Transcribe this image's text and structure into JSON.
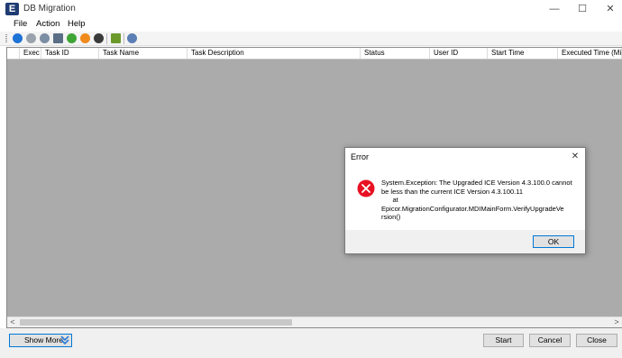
{
  "window": {
    "title": "DB Migration",
    "app_icon_letter": "E",
    "minimize_glyph": "—",
    "maximize_glyph": "☐",
    "close_glyph": "✕"
  },
  "menu": {
    "items": [
      "File",
      "Action",
      "Help"
    ]
  },
  "toolbar": {
    "icons": [
      {
        "name": "run-icon",
        "color": "#1e73d6"
      },
      {
        "name": "stop-icon",
        "color": "#9aa3ad"
      },
      {
        "name": "clock-icon",
        "color": "#7b8ea3"
      },
      {
        "name": "document-icon",
        "color": "#5a6f86"
      },
      {
        "name": "check-icon",
        "color": "#3fa535"
      },
      {
        "name": "orange-run-icon",
        "color": "#f08a1c"
      },
      {
        "name": "dark-stop-icon",
        "color": "#3a3a3a"
      },
      {
        "name": "export-icon",
        "color": "#6b9a2b"
      },
      {
        "name": "settings-icon",
        "color": "#5b7fb5"
      }
    ]
  },
  "grid": {
    "columns": [
      "Exec",
      "Task ID",
      "Task Name",
      "Task Description",
      "Status",
      "User ID",
      "Start Time",
      "Executed Time (Min)"
    ],
    "rows": []
  },
  "scrollbar": {
    "left_arrow": "<",
    "right_arrow": ">"
  },
  "bottom": {
    "show_more_label": "Show More",
    "start_label": "Start",
    "cancel_label": "Cancel",
    "close_label": "Close"
  },
  "dialog": {
    "title": "Error",
    "close_glyph": "✕",
    "message": "System.Exception: The Upgraded ICE Version 4.3.100.0 cannot\nbe less than the current ICE Version 4.3.100.11\n      at\nEpicor.MigrationConfigurator.MDIMainForm.VerifyUpgradeVe\nrsion()",
    "ok_label": "OK",
    "icon_color": "#e81123"
  }
}
